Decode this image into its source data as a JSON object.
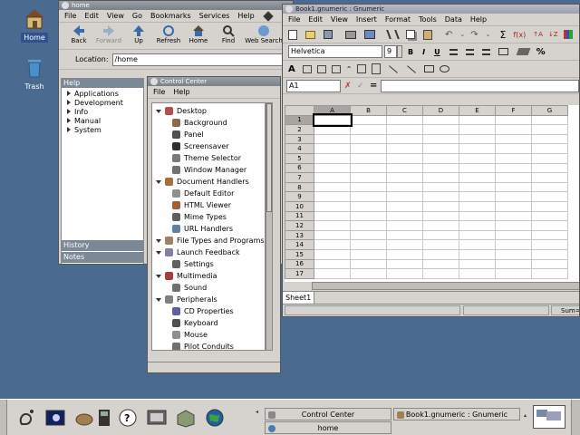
{
  "desktop": {
    "icons": [
      {
        "label": "Home"
      },
      {
        "label": "Trash"
      }
    ]
  },
  "nautilus": {
    "title": "home",
    "menu": [
      "File",
      "Edit",
      "View",
      "Go",
      "Bookmarks",
      "Services",
      "Help"
    ],
    "toolbar": [
      "Back",
      "Forward",
      "Up",
      "Refresh",
      "Home",
      "Find",
      "Web Search"
    ],
    "location_label": "Location:",
    "location_value": "/home",
    "sidebar_header": "Help",
    "help_items": [
      "Applications",
      "Development",
      "Info",
      "Manual",
      "System"
    ],
    "tabs": [
      "History",
      "Notes"
    ]
  },
  "control_center": {
    "title": "Control Center",
    "menu": [
      "File",
      "Help"
    ],
    "tree": [
      {
        "label": "Desktop",
        "level": 0
      },
      {
        "label": "Background",
        "level": 1
      },
      {
        "label": "Panel",
        "level": 1
      },
      {
        "label": "Screensaver",
        "level": 1
      },
      {
        "label": "Theme Selector",
        "level": 1
      },
      {
        "label": "Window Manager",
        "level": 1
      },
      {
        "label": "Document Handlers",
        "level": 0
      },
      {
        "label": "Default Editor",
        "level": 1
      },
      {
        "label": "HTML Viewer",
        "level": 1
      },
      {
        "label": "Mime Types",
        "level": 1
      },
      {
        "label": "URL Handlers",
        "level": 1
      },
      {
        "label": "File Types and Programs",
        "level": 0
      },
      {
        "label": "Launch Feedback",
        "level": 0
      },
      {
        "label": "Settings",
        "level": 1
      },
      {
        "label": "Multimedia",
        "level": 0
      },
      {
        "label": "Sound",
        "level": 1
      },
      {
        "label": "Peripherals",
        "level": 0
      },
      {
        "label": "CD Properties",
        "level": 1
      },
      {
        "label": "Keyboard",
        "level": 1
      },
      {
        "label": "Mouse",
        "level": 1
      },
      {
        "label": "Pilot Conduits",
        "level": 1
      }
    ]
  },
  "gnumeric": {
    "title": "Book1.gnumeric : Gnumeric",
    "menu": [
      "File",
      "Edit",
      "View",
      "Insert",
      "Format",
      "Tools",
      "Data",
      "Help"
    ],
    "font_name": "Helvetica",
    "font_size": "9",
    "cell_ref": "A1",
    "columns": [
      "A",
      "B",
      "C",
      "D",
      "E",
      "F",
      "G"
    ],
    "rows": [
      "1",
      "2",
      "3",
      "4",
      "5",
      "6",
      "7",
      "8",
      "9",
      "10",
      "11",
      "12",
      "13",
      "14",
      "15",
      "16",
      "17"
    ],
    "sheet_tab": "Sheet1",
    "status_right": "Sum="
  },
  "panel": {
    "tasks": [
      {
        "label": "Control Center"
      },
      {
        "label": "Book1.gnumeric : Gnumeric"
      },
      {
        "label": "home"
      }
    ]
  },
  "colors": {
    "desktop_bg": "#4a6a8f",
    "window_bg": "#d6d3ce",
    "selection": "#305090"
  }
}
